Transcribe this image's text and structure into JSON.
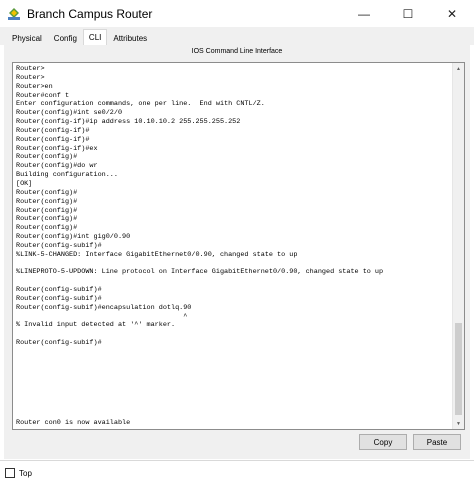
{
  "window": {
    "title": "Branch Campus Router",
    "controls": {
      "minimize": "—",
      "maximize": "☐",
      "close": "✕"
    }
  },
  "tabs": [
    {
      "label": "Physical"
    },
    {
      "label": "Config"
    },
    {
      "label": "CLI"
    },
    {
      "label": "Attributes"
    }
  ],
  "active_tab": "CLI",
  "panel": {
    "title": "IOS Command Line Interface",
    "console_lines": [
      "Router>",
      "Router>",
      "Router>en",
      "Router#conf t",
      "Enter configuration commands, one per line.  End with CNTL/Z.",
      "Router(config)#int se0/2/0",
      "Router(config-if)#ip address 10.10.10.2 255.255.255.252",
      "Router(config-if)#",
      "Router(config-if)#",
      "Router(config-if)#ex",
      "Router(config)#",
      "Router(config)#do wr",
      "Building configuration...",
      "[OK]",
      "Router(config)#",
      "Router(config)#",
      "Router(config)#",
      "Router(config)#",
      "Router(config)#",
      "Router(config)#int gig0/0.90",
      "Router(config-subif)#",
      "%LINK-5-CHANGED: Interface GigabitEthernet0/0.90, changed state to up",
      "",
      "%LINEPROTO-5-UPDOWN: Line protocol on Interface GigabitEthernet0/0.90, changed state to up",
      "",
      "Router(config-subif)#",
      "Router(config-subif)#",
      "Router(config-subif)#encapsulation dotlq.90",
      "                                         ^",
      "% Invalid input detected at '^' marker.",
      "",
      "Router(config-subif)#"
    ],
    "status_line": "Router con0 is now available",
    "copy_label": "Copy",
    "paste_label": "Paste"
  },
  "footer": {
    "top_label": "Top",
    "top_checked": false
  }
}
